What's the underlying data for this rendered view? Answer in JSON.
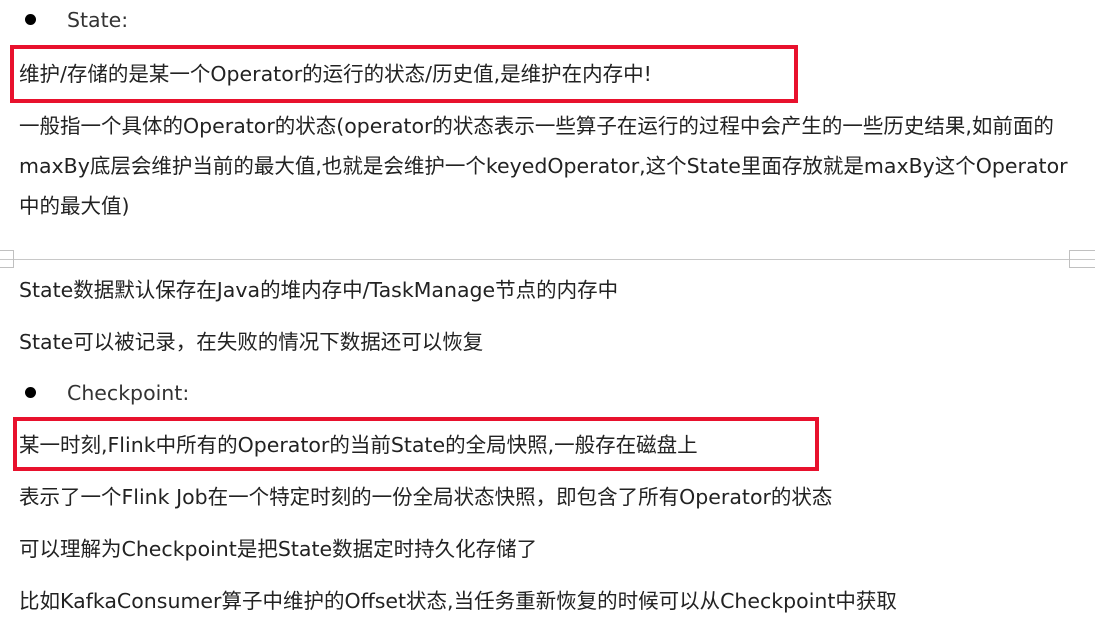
{
  "state": {
    "bullet_label": "State:",
    "highlighted": "维护/存储的是某一个Operator的运行的状态/历史值,是维护在内存中!",
    "description": "一般指一个具体的Operator的状态(operator的状态表示一些算子在运行的过程中会产生的一些历史结果,如前面的maxBy底层会维护当前的最大值,也就是会维护一个keyedOperator,这个State里面存放就是maxBy这个Operator中的最大值)",
    "storage_note": "State数据默认保存在Java的堆内存中/TaskManage节点的内存中",
    "recovery_note": "State可以被记录，在失败的情况下数据还可以恢复"
  },
  "checkpoint": {
    "bullet_label": "Checkpoint:",
    "highlighted": "某一时刻,Flink中所有的Operator的当前State的全局快照,一般存在磁盘上",
    "line1": "表示了一个Flink Job在一个特定时刻的一份全局状态快照，即包含了所有Operator的状态",
    "line2": "可以理解为Checkpoint是把State数据定时持久化存储了",
    "line3": "比如KafkaConsumer算子中维护的Offset状态,当任务重新恢复的时候可以从Checkpoint中获取"
  },
  "colors": {
    "highlight_border": "#e8112d",
    "text": "#222222",
    "page_break": "#c8c8c8"
  }
}
